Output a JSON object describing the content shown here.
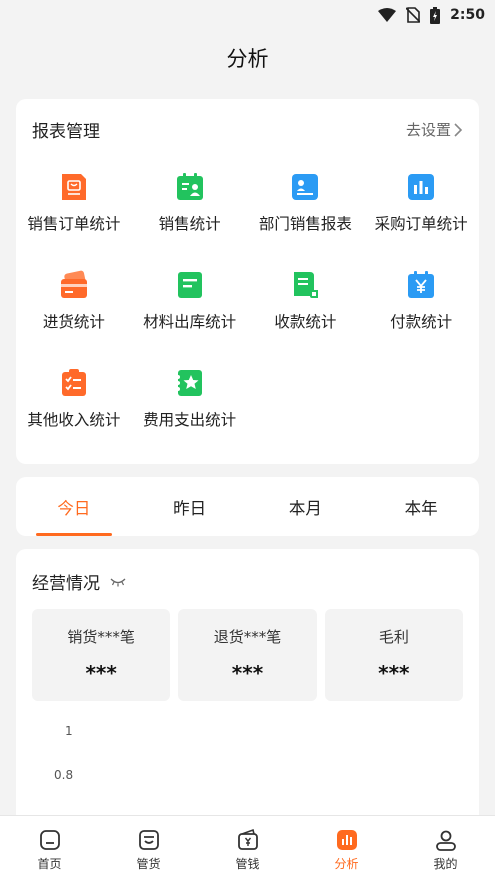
{
  "status": {
    "time": "2:50"
  },
  "header": {
    "title": "分析"
  },
  "report": {
    "title": "报表管理",
    "settings_label": "去设置",
    "items": [
      {
        "label": "销售订单统计",
        "icon": "sales-order-icon",
        "color": "#ff6a2a"
      },
      {
        "label": "销售统计",
        "icon": "sales-stats-icon",
        "color": "#22c35e"
      },
      {
        "label": "部门销售报表",
        "icon": "department-report-icon",
        "color": "#2b9bf4"
      },
      {
        "label": "采购订单统计",
        "icon": "purchase-order-icon",
        "color": "#2b9bf4"
      },
      {
        "label": "进货统计",
        "icon": "stock-in-icon",
        "color": "#ff6a2a"
      },
      {
        "label": "材料出库统计",
        "icon": "material-outbound-icon",
        "color": "#22c35e"
      },
      {
        "label": "收款统计",
        "icon": "receipt-icon",
        "color": "#22c35e"
      },
      {
        "label": "付款统计",
        "icon": "payment-icon",
        "color": "#2b9bf4"
      },
      {
        "label": "其他收入统计",
        "icon": "other-income-icon",
        "color": "#ff6a2a"
      },
      {
        "label": "费用支出统计",
        "icon": "expense-icon",
        "color": "#22c35e"
      }
    ]
  },
  "tabs": [
    {
      "label": "今日",
      "active": true
    },
    {
      "label": "昨日",
      "active": false
    },
    {
      "label": "本月",
      "active": false
    },
    {
      "label": "本年",
      "active": false
    }
  ],
  "business": {
    "title": "经营情况",
    "stats": [
      {
        "label": "销货***笔",
        "value": "***"
      },
      {
        "label": "退货***笔",
        "value": "***"
      },
      {
        "label": "毛利",
        "value": "***"
      }
    ],
    "y_ticks": [
      "1",
      "0.8"
    ]
  },
  "nav": [
    {
      "label": "首页",
      "icon": "home-icon",
      "active": false
    },
    {
      "label": "管货",
      "icon": "goods-icon",
      "active": false
    },
    {
      "label": "管钱",
      "icon": "money-icon",
      "active": false
    },
    {
      "label": "分析",
      "icon": "analysis-icon",
      "active": true
    },
    {
      "label": "我的",
      "icon": "profile-icon",
      "active": false
    }
  ],
  "colors": {
    "accent": "#ff6a1f",
    "green": "#22c35e",
    "blue": "#2b9bf4",
    "orange": "#ff6a2a"
  }
}
